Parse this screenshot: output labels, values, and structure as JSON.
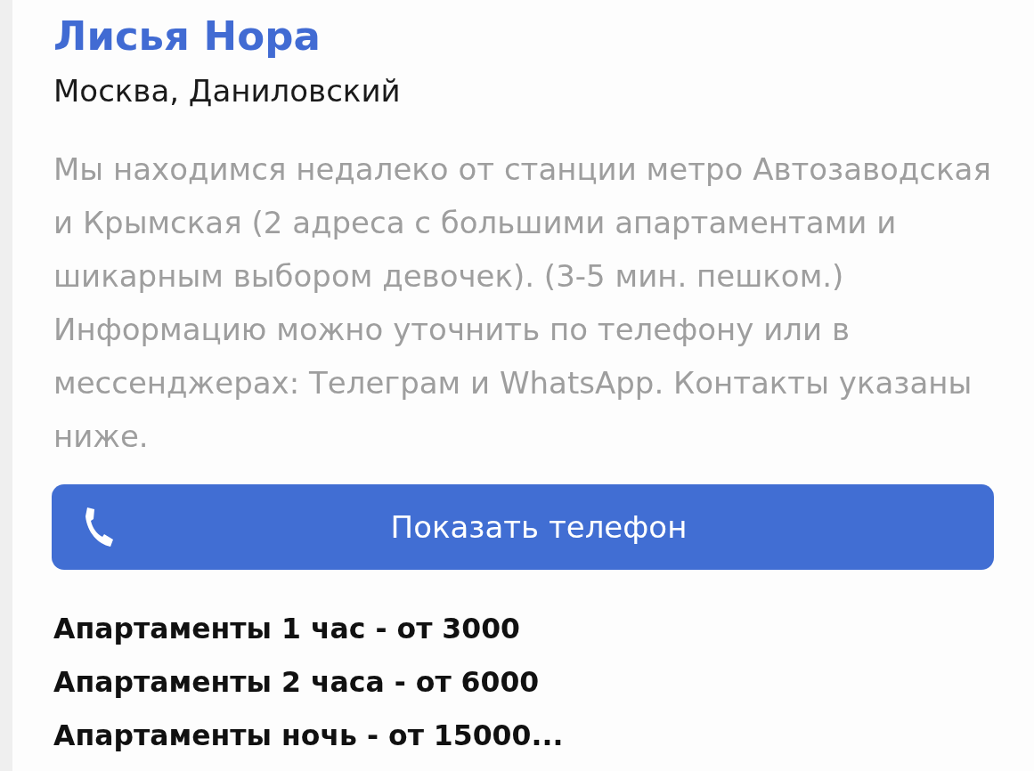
{
  "listing": {
    "title": "Лисья Нора",
    "location": "Москва, Даниловский",
    "description": "Мы находимся недалеко от станции метро Автозаводская и Крымская (2 адреса с большими апартаментами и шикарным выбором девочек). (3-5 мин. пешком.) Информацию можно уточнить по телефону или в мессенджерах: Телеграм и WhatsApp. Контакты указаны ниже."
  },
  "call_button": {
    "label": "Показать телефон"
  },
  "prices": [
    "Апартаменты 1 час - от 3000",
    "Апартаменты 2 часа - от 6000",
    "Апартаменты ночь - от 15000..."
  ]
}
